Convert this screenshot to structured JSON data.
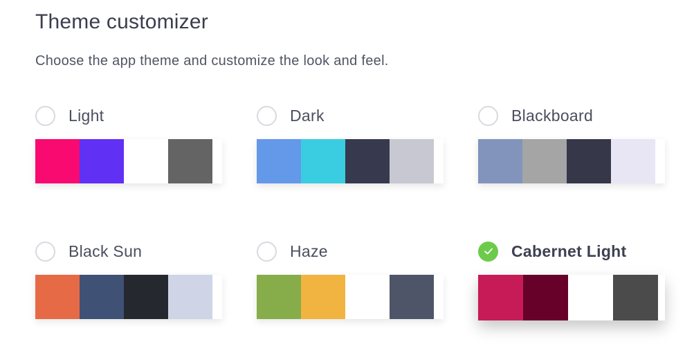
{
  "header": {
    "title": "Theme customizer",
    "subtitle": "Choose the app theme and customize the look and feel."
  },
  "themes": [
    {
      "name": "Light",
      "selected": false,
      "colors": [
        "#f80a71",
        "#6030f5",
        "#ffffff",
        "#646464"
      ]
    },
    {
      "name": "Dark",
      "selected": false,
      "colors": [
        "#6499e9",
        "#3acde2",
        "#373a4f",
        "#c8c8d3"
      ]
    },
    {
      "name": "Blackboard",
      "selected": false,
      "colors": [
        "#8294bb",
        "#a5a5a5",
        "#363749",
        "#e8e6f5"
      ]
    },
    {
      "name": "Black Sun",
      "selected": false,
      "colors": [
        "#e76a46",
        "#3f5175",
        "#262830",
        "#cfd4e6"
      ]
    },
    {
      "name": "Haze",
      "selected": false,
      "colors": [
        "#86ad4a",
        "#f2b440",
        "#ffffff",
        "#4f5568"
      ]
    },
    {
      "name": "Cabernet Light",
      "selected": true,
      "colors": [
        "#c71b58",
        "#670129",
        "#ffffff",
        "#4c4b4b"
      ]
    }
  ],
  "icons": {
    "selected": "checkmark-icon"
  },
  "accent": "#6ccb4a"
}
